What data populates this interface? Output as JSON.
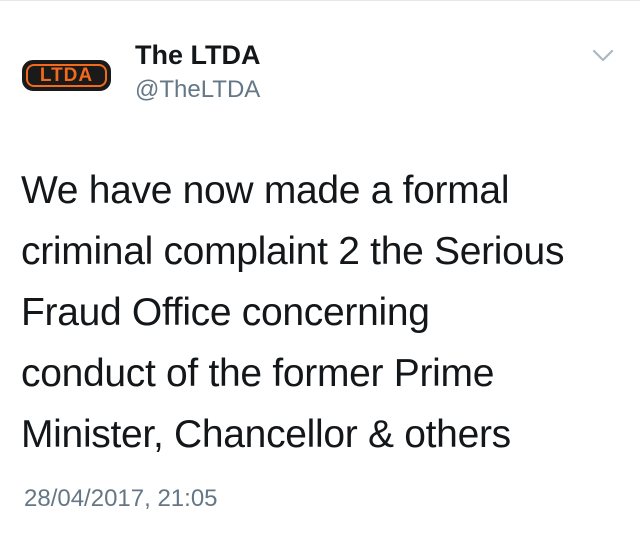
{
  "author": {
    "avatar_text": "LTDA",
    "display_name": "The LTDA",
    "handle": "@TheLTDA"
  },
  "tweet": {
    "lines": [
      "We have now made a formal",
      "criminal complaint 2 the Serious",
      "Fraud Office concerning",
      "conduct of the former Prime",
      "Minister, Chancellor & others"
    ],
    "timestamp": "28/04/2017, 21:05"
  },
  "icons": {
    "menu": "chevron-down-icon"
  },
  "colors": {
    "brand_orange": "#f26a1b",
    "avatar_background": "#1a1a1a",
    "primary_text": "#14171a",
    "secondary_text": "#657786",
    "chevron": "#aab8c2"
  }
}
